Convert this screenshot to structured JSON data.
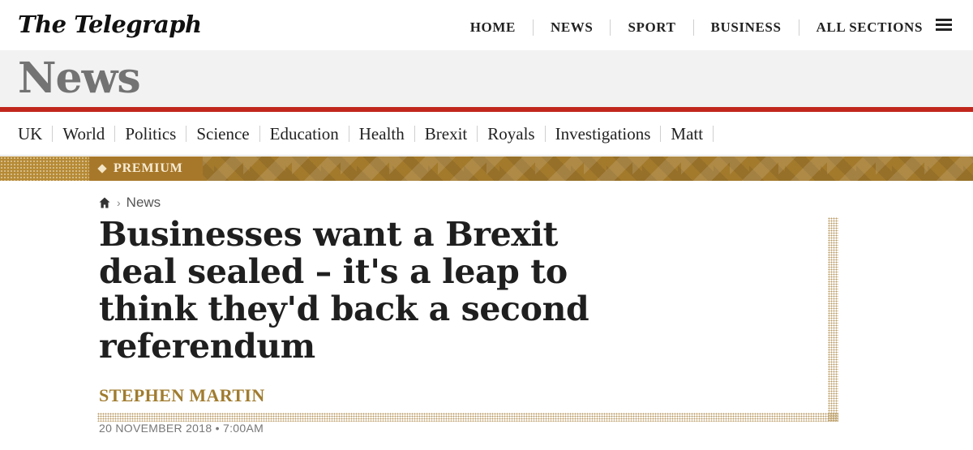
{
  "header": {
    "logo": "The Telegraph",
    "nav": [
      "HOME",
      "NEWS",
      "SPORT",
      "BUSINESS",
      "ALL SECTIONS"
    ],
    "menu_icon": "hamburger-menu-icon"
  },
  "section": {
    "title": "News",
    "accent_color": "#c1271d"
  },
  "subnav": {
    "items": [
      "UK",
      "World",
      "Politics",
      "Science",
      "Education",
      "Health",
      "Brexit",
      "Royals",
      "Investigations",
      "Matt"
    ]
  },
  "premium": {
    "label": "PREMIUM",
    "color": "#a37a2c"
  },
  "article": {
    "breadcrumb": {
      "home_icon": "home-icon",
      "separator": "›",
      "section": "News"
    },
    "headline": "Businesses want a Brexit deal sealed – it's a leap to think they'd back a second referendum",
    "author": "STEPHEN MARTIN",
    "author_color": "#a07c2f",
    "date": "20 NOVEMBER 2018 • 7:00AM"
  }
}
